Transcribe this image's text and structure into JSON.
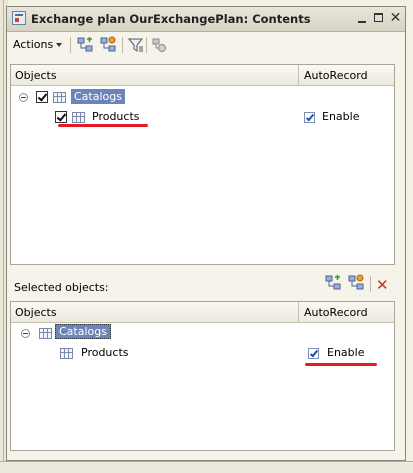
{
  "window": {
    "title": "Exchange plan OurExchangePlan: Contents"
  },
  "toolbar": {
    "actions_label": "Actions",
    "icons": [
      "add-object-icon",
      "remove-object-icon",
      "filter-icon",
      "refresh-icon"
    ]
  },
  "top_panel": {
    "columns": [
      "Objects",
      "AutoRecord"
    ],
    "rows": [
      {
        "label": "Catalogs",
        "checked": true,
        "selected": true,
        "level": 0,
        "expanded": true
      },
      {
        "label": "Products",
        "checked": true,
        "level": 1,
        "autorecord_label": "Enable",
        "autorecord": true
      }
    ]
  },
  "selected_objects": {
    "label": "Selected objects:",
    "icons": [
      "add-object-icon",
      "remove-object-icon",
      "delete-icon"
    ],
    "columns": [
      "Objects",
      "AutoRecord"
    ],
    "rows": [
      {
        "label": "Catalogs",
        "level": 0,
        "focused": true,
        "expanded": true
      },
      {
        "label": "Products",
        "level": 1,
        "autorecord_label": "Enable",
        "autorecord": true
      }
    ]
  },
  "colors": {
    "selection": "#6b84b9",
    "annotation_red": "#e31c25"
  }
}
